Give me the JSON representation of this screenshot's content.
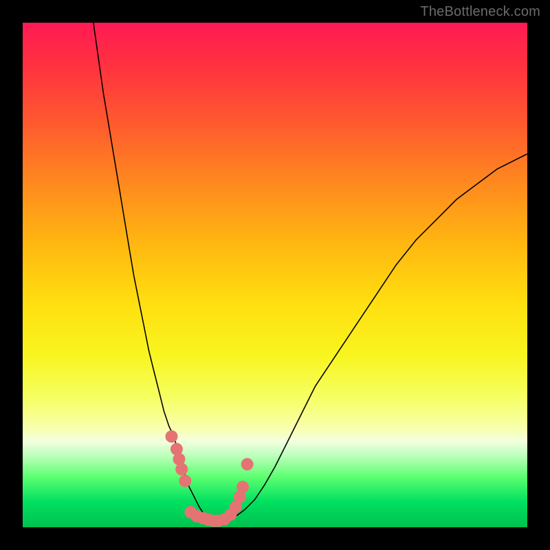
{
  "watermark": "TheBottleneck.com",
  "colors": {
    "curve": "#000000",
    "dot": "#e57373",
    "frame_bg": "#000000"
  },
  "chart_data": {
    "type": "line",
    "title": "",
    "xlabel": "",
    "ylabel": "",
    "xlim": [
      0,
      100
    ],
    "ylim": [
      0,
      100
    ],
    "grid": false,
    "legend": false,
    "series": [
      {
        "name": "left-branch",
        "x": [
          14,
          15,
          16,
          17,
          18,
          19,
          20,
          21,
          22,
          23,
          24,
          25,
          26,
          27,
          28,
          29,
          30,
          31,
          32,
          33,
          34,
          35,
          36,
          37,
          38
        ],
        "values": [
          100,
          93,
          86,
          80,
          74,
          68,
          62,
          56,
          50,
          45,
          40,
          35,
          31,
          27,
          23,
          20,
          18,
          14,
          11,
          8,
          6,
          4,
          2.5,
          1.3,
          0.6
        ]
      },
      {
        "name": "right-branch",
        "x": [
          38,
          40,
          42,
          44,
          46,
          48,
          50,
          52,
          55,
          58,
          62,
          66,
          70,
          74,
          78,
          82,
          86,
          90,
          94,
          98,
          100
        ],
        "values": [
          0.6,
          1.2,
          2.0,
          3.5,
          5.5,
          8.5,
          12,
          16,
          22,
          28,
          34,
          40,
          46,
          52,
          57,
          61,
          65,
          68,
          71,
          73,
          74
        ]
      }
    ],
    "dots": [
      {
        "x": 29.5,
        "y": 18.0
      },
      {
        "x": 30.5,
        "y": 15.5
      },
      {
        "x": 31.0,
        "y": 13.5
      },
      {
        "x": 31.5,
        "y": 11.5
      },
      {
        "x": 32.2,
        "y": 9.2
      },
      {
        "x": 33.3,
        "y": 3.0
      },
      {
        "x": 34.5,
        "y": 2.2
      },
      {
        "x": 35.8,
        "y": 1.8
      },
      {
        "x": 36.8,
        "y": 1.5
      },
      {
        "x": 37.8,
        "y": 1.3
      },
      {
        "x": 38.8,
        "y": 1.3
      },
      {
        "x": 40.0,
        "y": 1.6
      },
      {
        "x": 41.2,
        "y": 2.5
      },
      {
        "x": 42.2,
        "y": 4.0
      },
      {
        "x": 43.0,
        "y": 6.0
      },
      {
        "x": 43.6,
        "y": 8.0
      },
      {
        "x": 44.5,
        "y": 12.5
      }
    ]
  }
}
